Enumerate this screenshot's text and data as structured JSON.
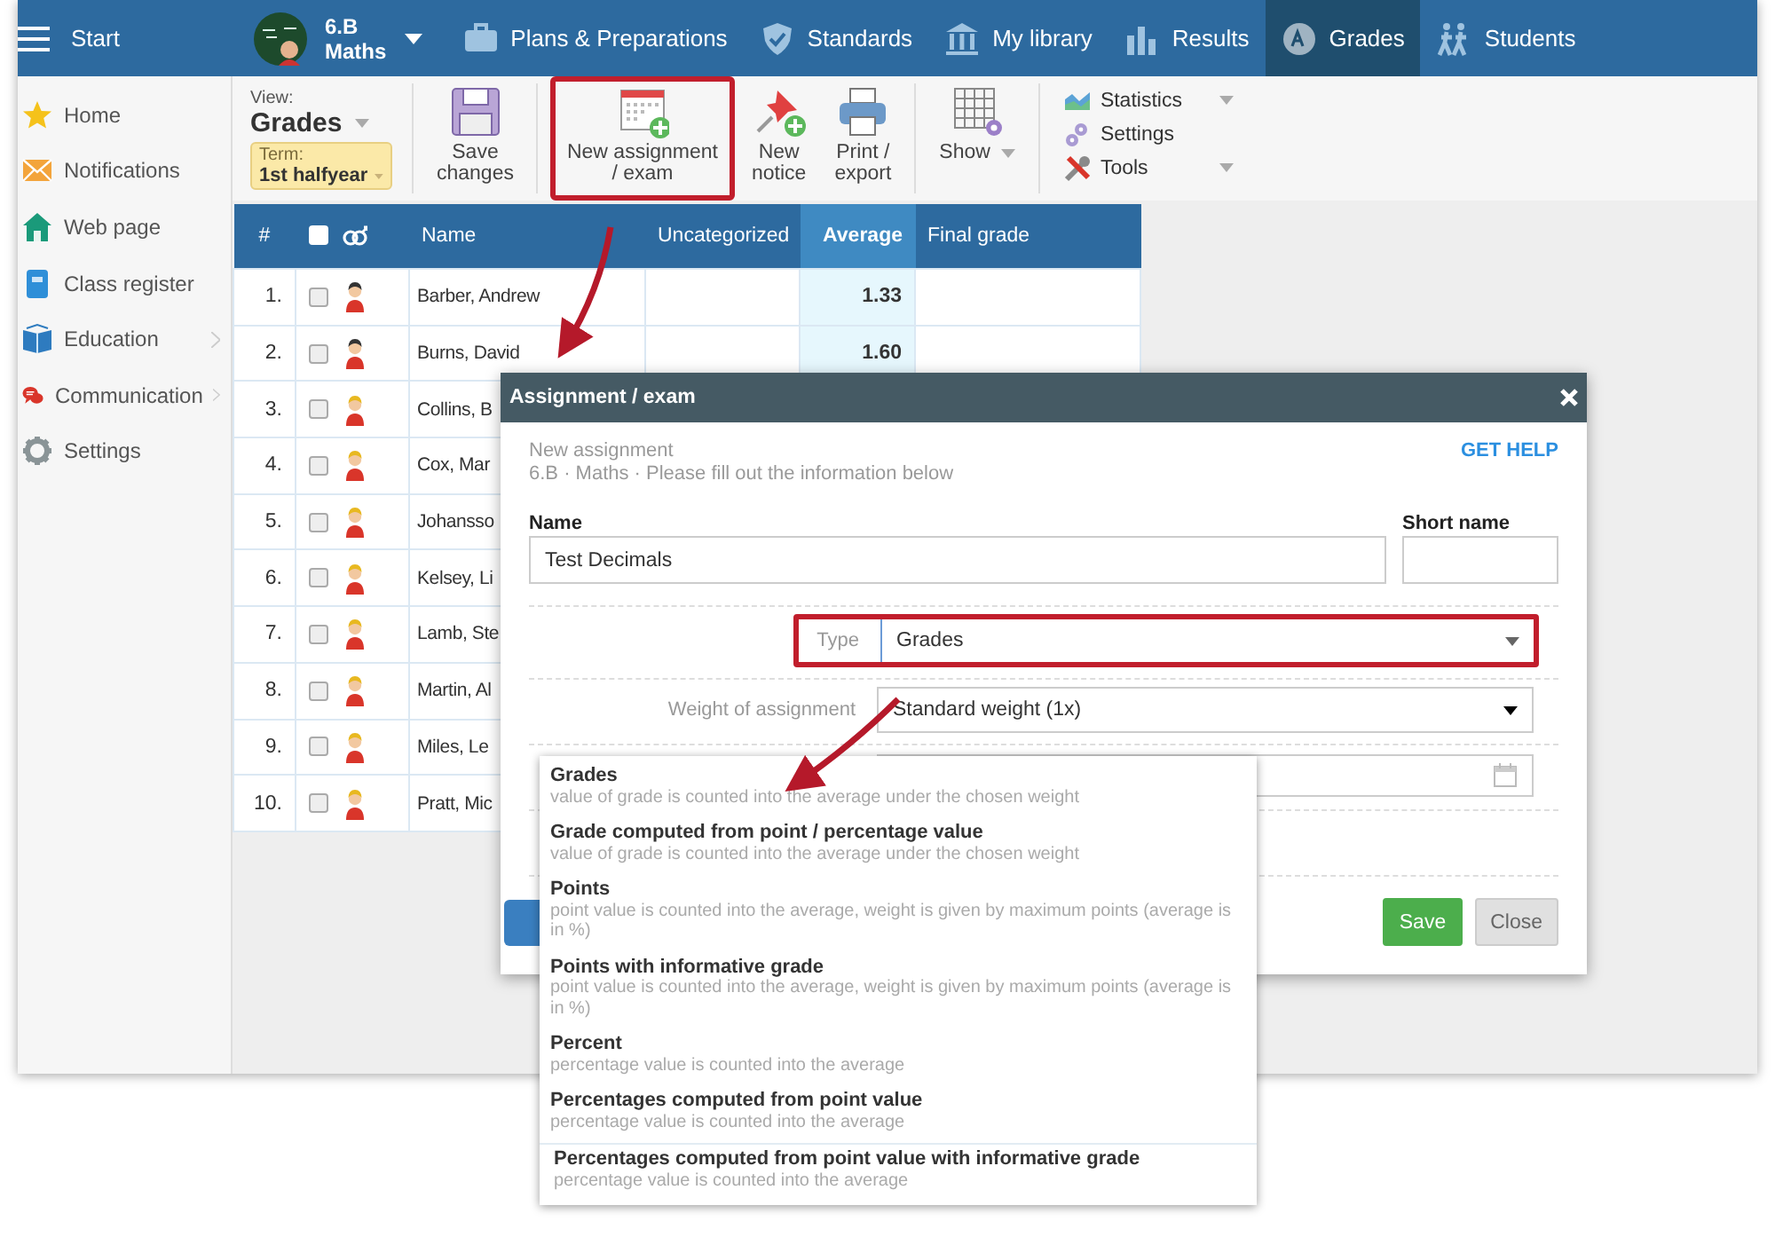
{
  "topbar": {
    "menu_label": "Start",
    "class_line1": "6.B",
    "class_line2": "Maths",
    "nav": [
      {
        "label": "Plans & Preparations",
        "selected": false
      },
      {
        "label": "Standards",
        "selected": false
      },
      {
        "label": "My library",
        "selected": false
      },
      {
        "label": "Results",
        "selected": false
      },
      {
        "label": "Grades",
        "selected": true
      },
      {
        "label": "Students",
        "selected": false
      }
    ]
  },
  "sidebar": {
    "items": [
      {
        "label": "Home",
        "submenu": false
      },
      {
        "label": "Notifications",
        "submenu": false
      },
      {
        "label": "Web page",
        "submenu": false
      },
      {
        "label": "Class register",
        "submenu": false
      },
      {
        "label": "Education",
        "submenu": true
      },
      {
        "label": "Communication",
        "submenu": true
      },
      {
        "label": "Settings",
        "submenu": false
      }
    ]
  },
  "toolbar": {
    "view_label": "View:",
    "view_value": "Grades",
    "term_label": "Term:",
    "term_value": "1st halfyear",
    "buttons": [
      {
        "lines": [
          "Save",
          "changes"
        ],
        "highlighted": false
      },
      {
        "lines": [
          "New assignment",
          "/ exam"
        ],
        "highlighted": true
      },
      {
        "lines": [
          "New",
          "notice"
        ],
        "highlighted": false
      },
      {
        "lines": [
          "Print /",
          "export"
        ],
        "highlighted": false
      },
      {
        "lines": [
          "Show"
        ],
        "highlighted": false
      }
    ],
    "menu": [
      {
        "label": "Statistics",
        "caret": true
      },
      {
        "label": "Settings",
        "caret": false
      },
      {
        "label": "Tools",
        "caret": true
      }
    ]
  },
  "table": {
    "select_all_checked": false,
    "columns": [
      {
        "label": "#",
        "selected": false
      },
      {
        "label": "Name",
        "selected": false
      },
      {
        "label": "Uncategorized",
        "selected": false
      },
      {
        "label": "Average",
        "selected": true
      },
      {
        "label": "Final grade",
        "selected": false
      }
    ],
    "rows": [
      {
        "number": "1.",
        "checked": false,
        "color": "#333333",
        "name": "Barber, Andrew",
        "average": "1.33"
      },
      {
        "number": "2.",
        "checked": false,
        "color": "#333333",
        "name": "Burns, David",
        "average": "1.60"
      },
      {
        "number": "3.",
        "checked": false,
        "color": "#e8b820",
        "name": "Collins, B"
      },
      {
        "number": "4.",
        "checked": false,
        "color": "#e8b820",
        "name": "Cox, Mar"
      },
      {
        "number": "5.",
        "checked": false,
        "color": "#e8b820",
        "name": "Johansso"
      },
      {
        "number": "6.",
        "checked": false,
        "color": "#e8b820",
        "name": "Kelsey, Li"
      },
      {
        "number": "7.",
        "checked": false,
        "color": "#e8b820",
        "name": "Lamb, Ste"
      },
      {
        "number": "8.",
        "checked": false,
        "color": "#e8b820",
        "name": "Martin, Al"
      },
      {
        "number": "9.",
        "checked": false,
        "color": "#e8b820",
        "name": "Miles, Le"
      },
      {
        "number": "10.",
        "checked": false,
        "color": "#e8b820",
        "name": "Pratt, Mic"
      }
    ]
  },
  "dialog": {
    "title": "Assignment / exam",
    "subtitle": "New assignment",
    "context": "6.B · Maths · Please fill out the information below",
    "help_link": "GET HELP",
    "name_label": "Name",
    "name_value": "Test Decimals",
    "short_name_label": "Short name",
    "type_label": "Type",
    "type_value": "Grades",
    "type_highlighted": true,
    "weight_label": "Weight of assignment",
    "weight_value": "Standard weight (1x)",
    "buttons": [
      {
        "label": "Save",
        "kind": "primary"
      },
      {
        "label": "Close",
        "kind": "secondary"
      }
    ]
  },
  "type_dropdown": {
    "options": [
      {
        "title": "Grades",
        "description": "value of grade is counted into the average under the chosen weight",
        "hovered": false
      },
      {
        "title": "Grade computed from point / percentage value",
        "description": "value of grade is counted into the average under the chosen weight",
        "hovered": false
      },
      {
        "title": "Points",
        "description": "point value is counted into the average, weight is given by maximum points (average is in %)",
        "hovered": false
      },
      {
        "title": "Points with informative grade",
        "description": "point value is counted into the average, weight is given by maximum points (average is in %)",
        "hovered": false
      },
      {
        "title": "Percent",
        "description": "percentage value is counted into the average",
        "hovered": false
      },
      {
        "title": "Percentages computed from point value",
        "description": "percentage value is counted into the average",
        "hovered": false
      },
      {
        "title": "Percentages computed from point value with informative grade",
        "description": "percentage value is counted into the average",
        "hovered": true
      }
    ]
  }
}
